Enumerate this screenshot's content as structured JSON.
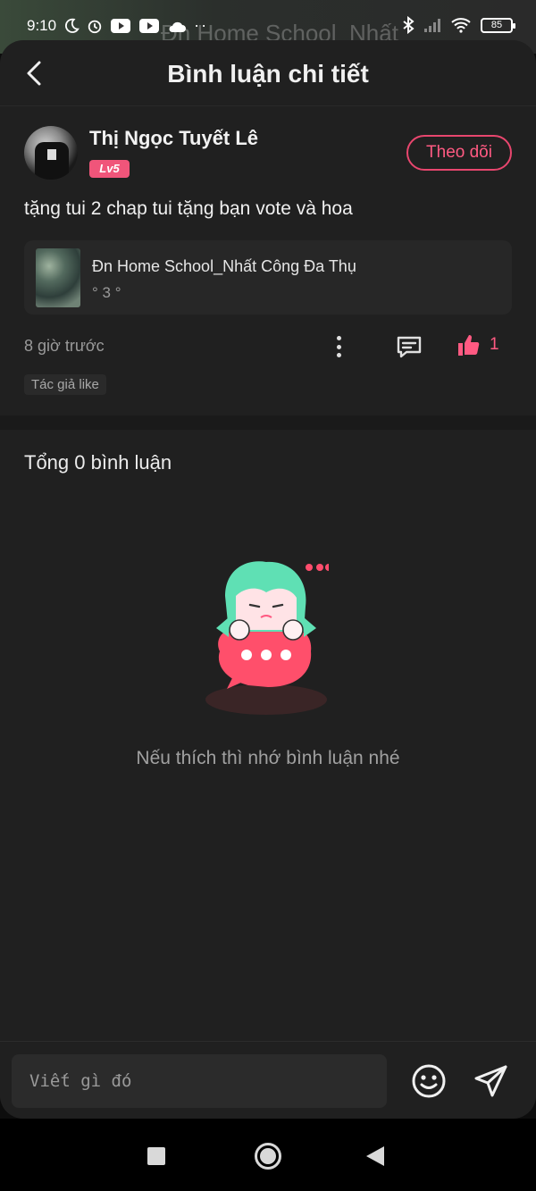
{
  "status_bar": {
    "time": "9:10",
    "battery": "85",
    "background_text": "Đn Home School_Nhất"
  },
  "header": {
    "title": "Bình luận chi tiết"
  },
  "post": {
    "username": "Thị Ngọc Tuyết Lê",
    "level": "Lv5",
    "follow_label": "Theo dõi",
    "content": "tặng tui 2 chap tui tặng bạn vote và hoa",
    "book": {
      "title": "Đn Home School_Nhất Công Đa Thụ",
      "chapter": "° 3 °"
    },
    "time_ago": "8 giờ trước",
    "like_count": "1",
    "author_like_tag": "Tác giả like"
  },
  "comments": {
    "total_label": "Tổng 0 bình luận",
    "empty_text": "Nếu thích thì nhớ bình luận nhé"
  },
  "input": {
    "placeholder": "Viết gì đó"
  },
  "colors": {
    "accent": "#ff5a82",
    "sheet_bg": "#202020",
    "level_badge": "#f0557a"
  },
  "icons": {
    "back": "chevron-left-icon",
    "more": "more-vertical-icon",
    "comment": "comment-icon",
    "like": "thumbs-up-icon",
    "emoji": "smiley-icon",
    "send": "send-icon"
  }
}
